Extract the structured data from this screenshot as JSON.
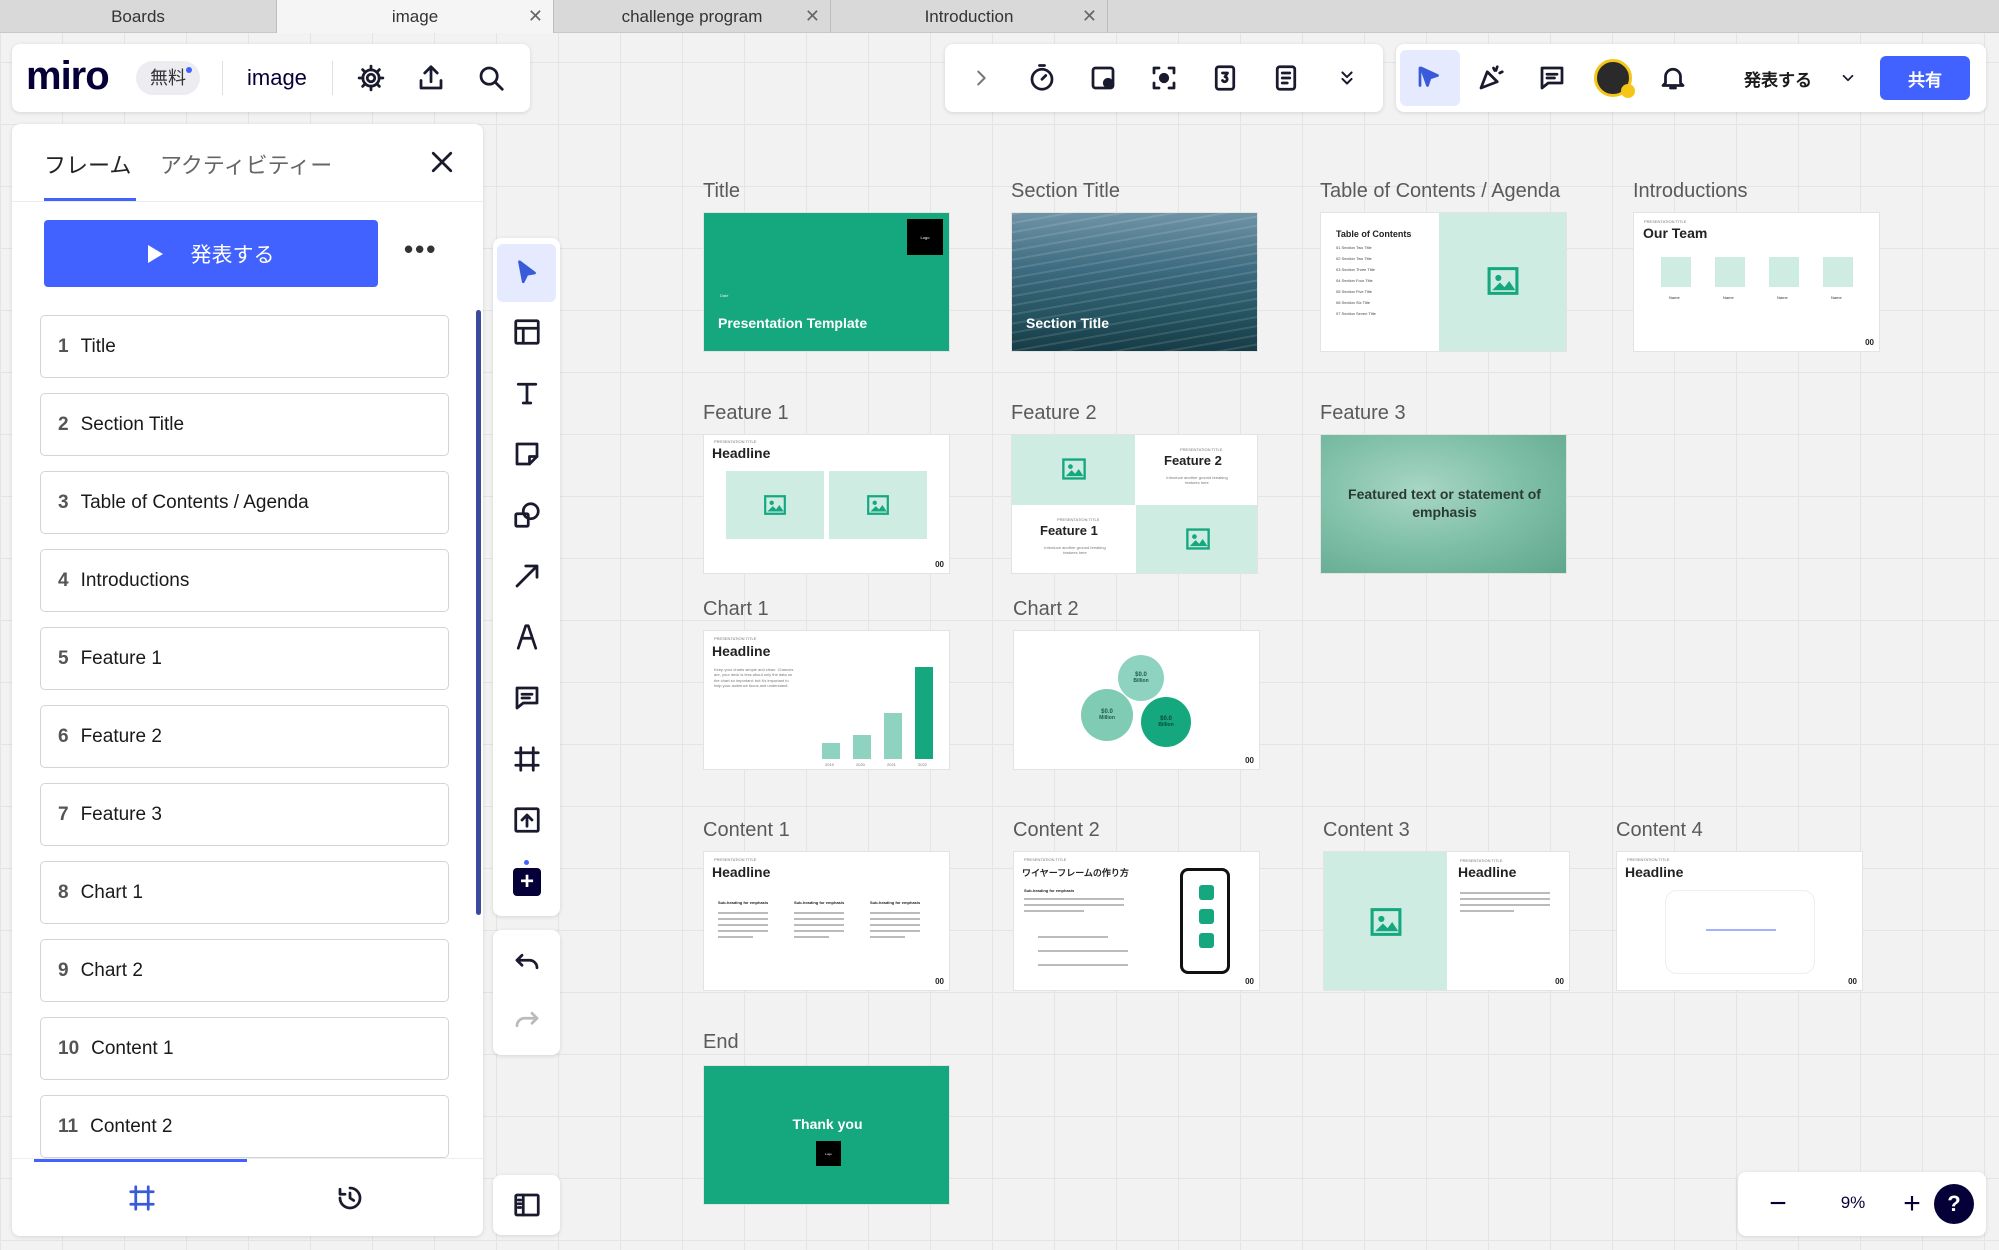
{
  "tabs": [
    {
      "label": "Boards",
      "active": false,
      "closable": false
    },
    {
      "label": "image",
      "active": true,
      "closable": true
    },
    {
      "label": "challenge program",
      "active": false,
      "closable": true
    },
    {
      "label": "Introduction",
      "active": false,
      "closable": true
    }
  ],
  "header": {
    "logo": "miro",
    "plan_badge": "無料",
    "board_name": "image",
    "icons": [
      "gear-icon",
      "upload-icon",
      "search-icon"
    ]
  },
  "toolbar_right": {
    "icons": [
      "chevron-right-icon",
      "timer-icon",
      "frame-add-icon",
      "focus-icon",
      "counter-icon",
      "notes-icon",
      "double-chevron-down-icon",
      "select-cursor-icon",
      "celebrate-icon",
      "comment-icon",
      "avatar",
      "bell-icon"
    ],
    "present_label": "発表する",
    "share_label": "共有",
    "accent": "#4262ff"
  },
  "sidebar": {
    "tabs": [
      {
        "label": "フレーム",
        "active": true
      },
      {
        "label": "アクティビティー",
        "active": false
      }
    ],
    "present_button": "発表する",
    "items": [
      {
        "num": "1",
        "label": "Title"
      },
      {
        "num": "2",
        "label": "Section Title"
      },
      {
        "num": "3",
        "label": "Table of Contents / Agenda"
      },
      {
        "num": "4",
        "label": "Introductions"
      },
      {
        "num": "5",
        "label": "Feature 1"
      },
      {
        "num": "6",
        "label": "Feature 2"
      },
      {
        "num": "7",
        "label": "Feature 3"
      },
      {
        "num": "8",
        "label": "Chart 1"
      },
      {
        "num": "9",
        "label": "Chart 2"
      },
      {
        "num": "10",
        "label": "Content 1"
      },
      {
        "num": "11",
        "label": "Content 2"
      }
    ]
  },
  "tools": [
    "select-cursor-icon",
    "templates-icon",
    "text-icon",
    "sticky-note-icon",
    "shapes-icon",
    "arrow-icon",
    "pen-icon",
    "comment-icon",
    "frame-icon",
    "upload-icon",
    "add-icon",
    "undo-icon",
    "redo-icon"
  ],
  "zoom": {
    "value": "9%",
    "minus": "−",
    "plus": "+",
    "help": "?"
  },
  "frames": {
    "title": {
      "label": "Title",
      "small": "Date",
      "heading": "Presentation Template",
      "logo": "Logo"
    },
    "section": {
      "label": "Section Title",
      "heading": "Section Title"
    },
    "toc": {
      "label": "Table of Contents / Agenda",
      "heading": "Table of Contents",
      "items": [
        "01 Section Two Title",
        "02 Section Two Title",
        "03 Section Three Title",
        "04 Section Four Title",
        "05 Section Five Title",
        "06 Section Six Title",
        "07 Section Seven Title"
      ]
    },
    "intro": {
      "label": "Introductions",
      "kicker": "PRESENTATION TITLE",
      "heading": "Our Team",
      "names": [
        "Name",
        "Name",
        "Name",
        "Name"
      ],
      "pnum": "00"
    },
    "f1": {
      "label": "Feature 1",
      "kicker": "PRESENTATION TITLE",
      "heading": "Headline",
      "pnum": "00"
    },
    "f2": {
      "label": "Feature 2",
      "kicker": "PRESENTATION TITLE",
      "h1": "Feature 2",
      "h2": "Feature 1",
      "sub": "Introduce another ground breaking features here"
    },
    "f3": {
      "label": "Feature 3",
      "text": "Featured text or statement of emphasis"
    },
    "c1": {
      "label": "Chart 1",
      "kicker": "PRESENTATION TITLE",
      "heading": "Headline",
      "body": "Keep your charts simple and clean. Chances are, your deck is less about only the data on the chart so important: but it's important to help your audience focus and understand.",
      "years": [
        "2019",
        "2020",
        "2021",
        "2022"
      ],
      "pnum": "00"
    },
    "c2": {
      "label": "Chart 2",
      "bubbles": [
        {
          "value": "$0.0",
          "unit": "Billion"
        },
        {
          "value": "$0.0",
          "unit": "Million"
        },
        {
          "value": "$0.0",
          "unit": "Billion"
        }
      ],
      "pnum": "00"
    },
    "ct1": {
      "label": "Content 1",
      "kicker": "PRESENTATION TITLE",
      "heading": "Headline",
      "sub": "Sub-heading for emphasis",
      "pnum": "00"
    },
    "ct2": {
      "label": "Content 2",
      "kicker": "PRESENTATION TITLE",
      "heading": "ワイヤーフレームの作り方",
      "sub": "Sub-heading for emphasis",
      "pnum": "00"
    },
    "ct3": {
      "label": "Content 3",
      "kicker": "PRESENTATION TITLE",
      "heading": "Headline",
      "pnum": "00"
    },
    "ct4": {
      "label": "Content 4",
      "kicker": "PRESENTATION TITLE",
      "heading": "Headline",
      "pnum": "00"
    },
    "end": {
      "label": "End",
      "heading": "Thank you",
      "logo": "Logo"
    }
  },
  "colors": {
    "teal": "#15a87f",
    "mint": "#cfece3",
    "accent": "#4262ff"
  }
}
